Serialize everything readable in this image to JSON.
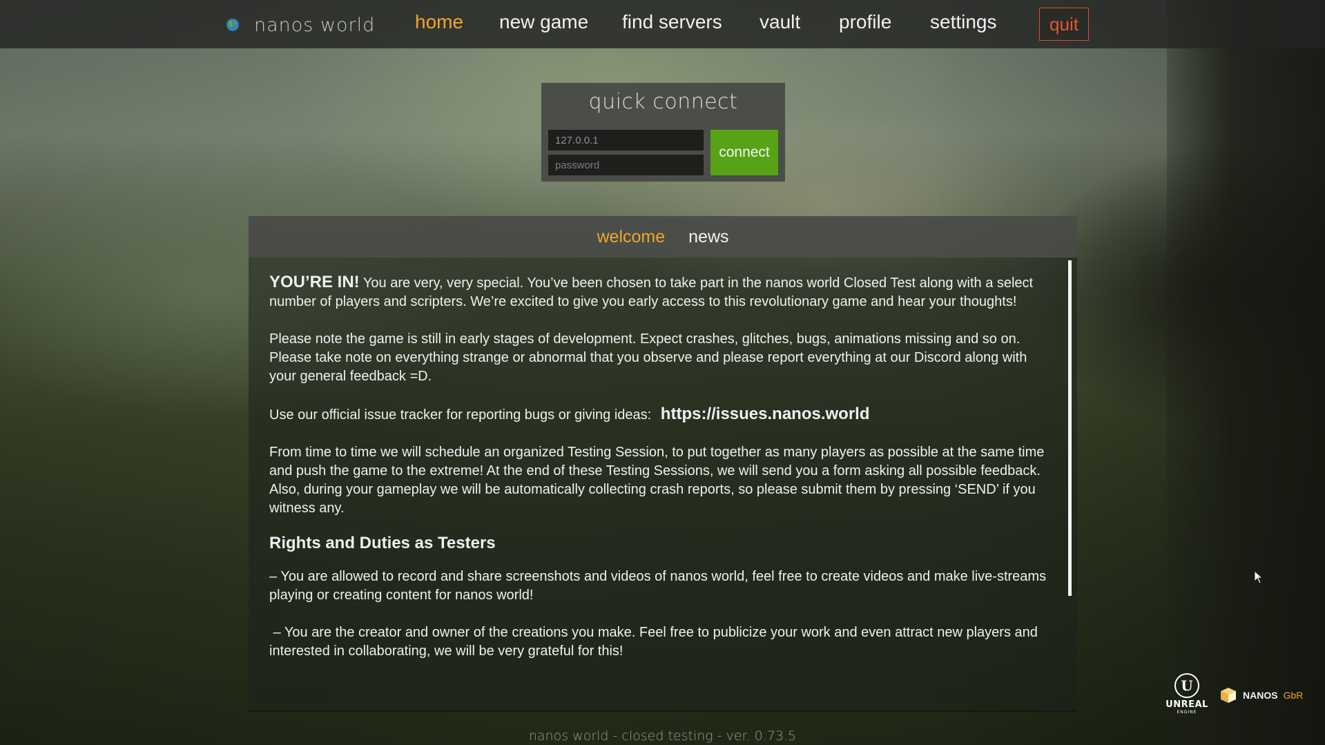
{
  "header": {
    "brand_name": "nanos world",
    "nav": [
      {
        "label": "home",
        "active": true
      },
      {
        "label": "new game"
      },
      {
        "label": "find servers"
      },
      {
        "label": "vault"
      },
      {
        "label": "profile"
      },
      {
        "label": "settings"
      }
    ],
    "quit_label": "quit"
  },
  "quick_connect": {
    "title": "quick connect",
    "address_value": "127.0.0.1",
    "password_placeholder": "password",
    "connect_label": "connect"
  },
  "tabs": [
    {
      "label": "welcome",
      "active": true
    },
    {
      "label": "news"
    }
  ],
  "welcome": {
    "lead": "YOU’RE IN!",
    "intro": "You are very, very special. You’ve been chosen to take part in the nanos world Closed Test along with a select number of players and scripters. We’re excited to give you early access to this revolutionary game and hear your thoughts!",
    "note": "Please note the game is still in early stages of development. Expect crashes, glitches, bugs, animations missing and so on. Please take note on everything strange or abnormal that you observe and please report everything at our Discord along with your general feedback =D.",
    "tracker_text": "Use our official issue tracker for reporting bugs or giving ideas:",
    "tracker_link": "https://issues.nanos.world",
    "sessions": "From time to time we will schedule an organized Testing Session, to put together as many players as possible at the same time and push the game to the extreme! At the end of these Testing Sessions, we will send you a form asking all possible feedback. Also, during your gameplay we will be automatically collecting crash reports, so please submit them by pressing ‘SEND’ if you witness any.",
    "rights_heading": "Rights and Duties as Testers",
    "right_1": "– You are allowed to record and share screenshots and videos of nanos world, feel free to create videos and make live-streams playing or creating content for nanos world!",
    "right_2": " – You are the creator and owner of the creations you make. Feel free to publicize your work and even attract new players and interested in collaborating, we will be very grateful for this!"
  },
  "footer": {
    "version": "nanos world - closed testing - ver. 0.73.5",
    "unreal_text": "UNREAL",
    "unreal_sub": "ENGINE",
    "nanos_text": "NANOS",
    "nanos_gbr": "GbR"
  },
  "colors": {
    "accent": "#f0a62a",
    "quit": "#e6562f",
    "connect": "#57a315"
  }
}
